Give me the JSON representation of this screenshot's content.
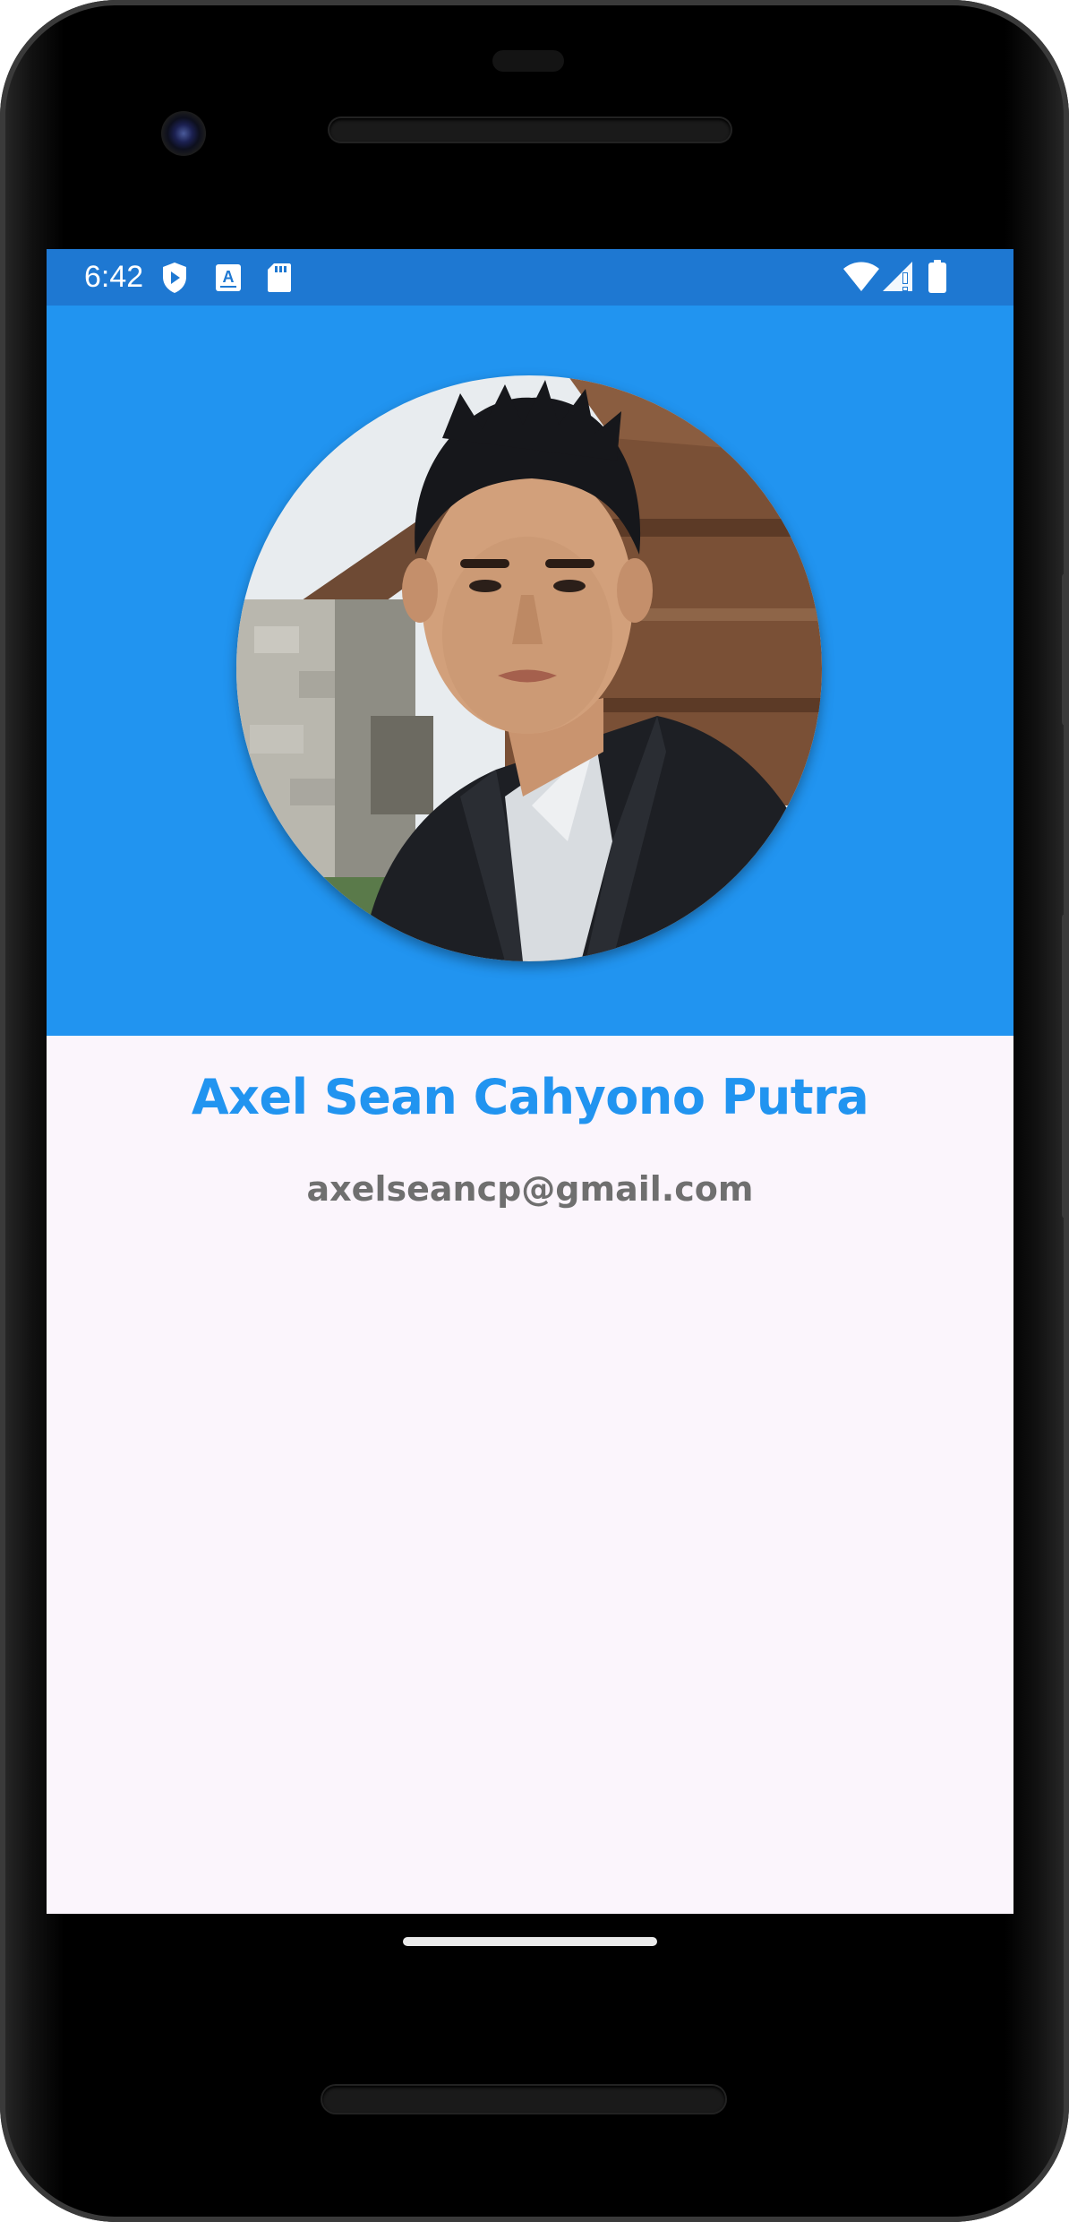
{
  "status_bar": {
    "time": "6:42",
    "icons_left": [
      "play-protect-icon",
      "keyboard-a-icon",
      "sd-card-icon"
    ],
    "icons_right": [
      "wifi-icon",
      "cell-signal-icon",
      "battery-icon"
    ]
  },
  "profile": {
    "name": "Axel Sean Cahyono Putra",
    "email": "axelseancp@gmail.com",
    "avatar_alt": "profile-photo"
  },
  "colors": {
    "status_bar": "#1e78d2",
    "header": "#2194f0",
    "name_text": "#2194f0",
    "email_text": "#6f6f6f",
    "background": "#fbf5fc"
  }
}
